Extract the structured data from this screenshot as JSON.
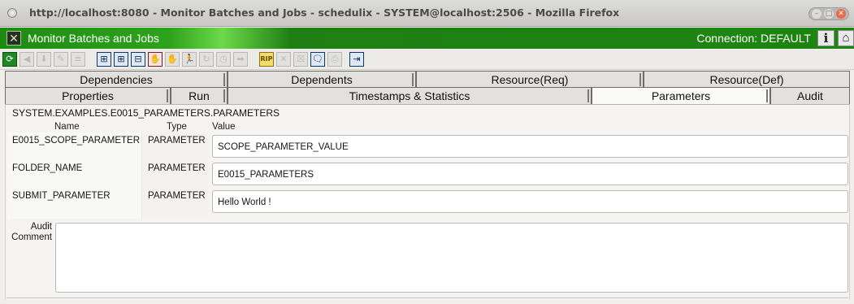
{
  "window": {
    "title": "http://localhost:8080 - Monitor Batches and Jobs - schedulix - SYSTEM@localhost:2506 - Mozilla Firefox"
  },
  "app": {
    "title": "Monitor Batches and Jobs",
    "connection": "Connection:  DEFAULT",
    "info_glyph": "i",
    "home_glyph": "⌂"
  },
  "toolbar": {
    "buttons": [
      {
        "name": "refresh",
        "glyph": "⟳"
      },
      {
        "name": "back",
        "glyph": "◀"
      },
      {
        "name": "download",
        "glyph": "⬇"
      },
      {
        "name": "edit",
        "glyph": "✎"
      },
      {
        "name": "list",
        "glyph": "≡"
      },
      {
        "name": "expand-all",
        "glyph": "⊞"
      },
      {
        "name": "expand",
        "glyph": "⊞"
      },
      {
        "name": "collapse",
        "glyph": "⊟"
      },
      {
        "name": "stop",
        "glyph": "✋"
      },
      {
        "name": "suspend",
        "glyph": "✋"
      },
      {
        "name": "run",
        "glyph": "🏃"
      },
      {
        "name": "rerun",
        "glyph": "↻"
      },
      {
        "name": "clock",
        "glyph": "◷"
      },
      {
        "name": "forward",
        "glyph": "➡"
      },
      {
        "name": "rip",
        "glyph": "RIP"
      },
      {
        "name": "cancel",
        "glyph": "✕"
      },
      {
        "name": "kill",
        "glyph": "☒"
      },
      {
        "name": "comment",
        "glyph": "🗨"
      },
      {
        "name": "print",
        "glyph": "⎙"
      },
      {
        "name": "goto",
        "glyph": "⇥"
      }
    ]
  },
  "tabs_row1": [
    "Dependencies",
    "Dependents",
    "Resource(Req)",
    "Resource(Def)"
  ],
  "tabs_row2": [
    "Properties",
    "Run",
    "Timestamps & Statistics",
    "Parameters",
    "Audit"
  ],
  "active_tab": "Parameters",
  "parameters": {
    "path": "SYSTEM.EXAMPLES.E0015_PARAMETERS.PARAMETERS",
    "headers": {
      "name": "Name",
      "type": "Type",
      "value": "Value"
    },
    "rows": [
      {
        "name": "E0015_SCOPE_PARAMETER",
        "type": "PARAMETER",
        "value": "SCOPE_PARAMETER_VALUE"
      },
      {
        "name": "FOLDER_NAME",
        "type": "PARAMETER",
        "value": "E0015_PARAMETERS"
      },
      {
        "name": "SUBMIT_PARAMETER",
        "type": "PARAMETER",
        "value": "Hello World !"
      }
    ],
    "audit_label_line1": "Audit",
    "audit_label_line2": "Comment",
    "audit_comment": ""
  }
}
